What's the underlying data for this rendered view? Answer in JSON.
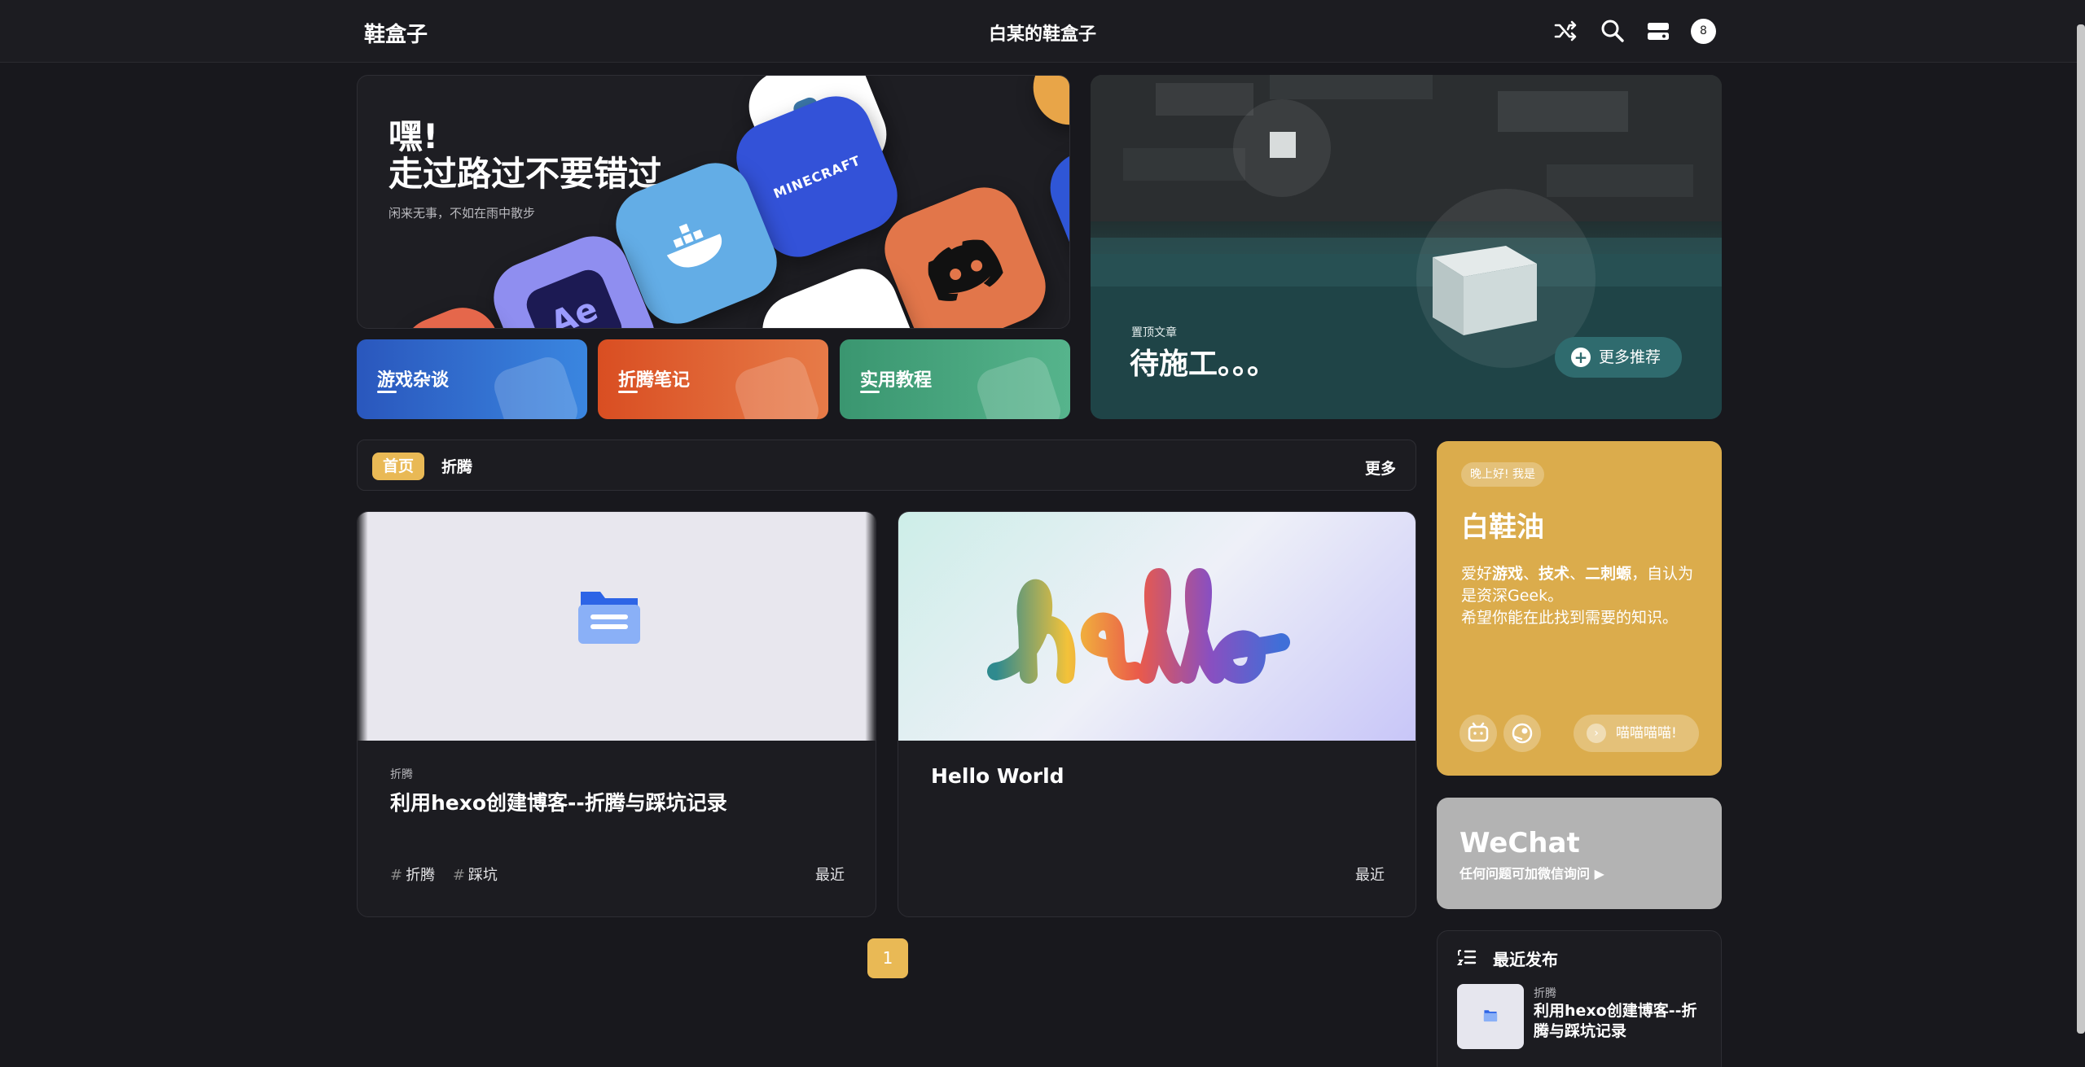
{
  "header": {
    "brand": "鞋盒子",
    "site_title": "白某的鞋盒子",
    "badge_count": "8",
    "icons": [
      "shuffle-icon",
      "search-icon",
      "toggle-icon"
    ]
  },
  "hero": {
    "title_line1": "嘿!",
    "title_line2": "走过路过不要错过",
    "subtitle": "闲来无事，不如在雨中散步",
    "apps": [
      "MINECRAFT",
      "Ae"
    ]
  },
  "categories": [
    {
      "label": "游戏杂谈",
      "color": "#2d61c4"
    },
    {
      "label": "折腾笔记",
      "color": "#db5a2e"
    },
    {
      "label": "实用教程",
      "color": "#3f9a73"
    }
  ],
  "featured": {
    "label": "置顶文章",
    "title": "待施工。。。",
    "more_label": "更多推荐"
  },
  "tabs": {
    "active": "首页",
    "items": [
      "折腾"
    ],
    "more": "更多"
  },
  "posts": [
    {
      "category": "折腾",
      "title": "利用hexo创建博客--折腾与踩坑记录",
      "tags": [
        "折腾",
        "踩坑"
      ],
      "date": "最近"
    },
    {
      "category": "",
      "title": "Hello World",
      "tags": [],
      "date": "最近",
      "cover_text": "hello"
    }
  ],
  "pagination": {
    "current": "1"
  },
  "profile": {
    "greeting": "晚上好! 我是",
    "name": "白鞋油",
    "desc_prefix": "爱好",
    "hobby1": "游戏",
    "sep1": "、",
    "hobby2": "技术",
    "sep2": "、",
    "hobby3": "二刺螈",
    "desc_suffix": "，自认为是资深Geek。",
    "desc_line2": "希望你能在此找到需要的知识。",
    "meow": "喵喵喵喵!"
  },
  "wechat": {
    "title": "WeChat",
    "subtitle": "任何问题可加微信询问 ▶"
  },
  "recent": {
    "heading": "最近发布",
    "item": {
      "category": "折腾",
      "title": "利用hexo创建博客--折腾与踩坑记录"
    }
  }
}
